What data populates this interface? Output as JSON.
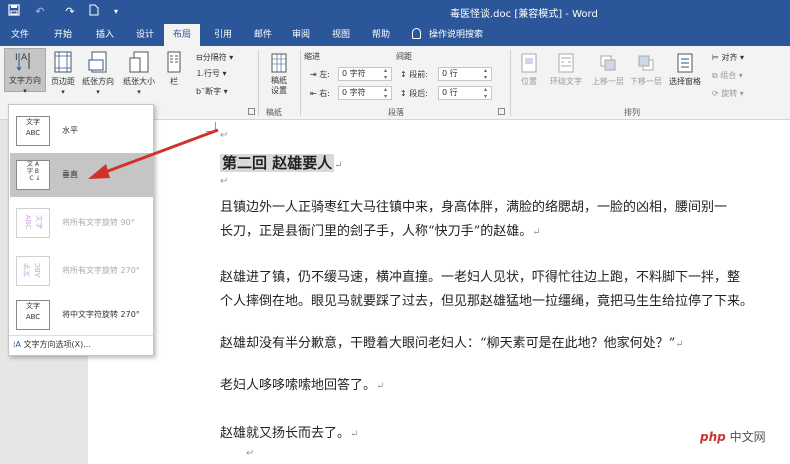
{
  "titlebar": {
    "title": "毒医怪谈.doc [兼容模式] - Word"
  },
  "menu": {
    "tabs": [
      "文件",
      "开始",
      "插入",
      "设计",
      "布局",
      "引用",
      "邮件",
      "审阅",
      "视图",
      "帮助"
    ],
    "active_tab": "布局",
    "tell_me": "操作说明搜索"
  },
  "ribbon": {
    "page_setup": {
      "text_direction": "文字方向",
      "margins": "页边距",
      "orientation": "纸张方向",
      "size": "纸张大小",
      "columns": "栏",
      "breaks": "分隔符",
      "line_numbers": "行号",
      "hyphenation": "断字"
    },
    "draft": {
      "label": "稿纸设置",
      "group": "稿纸"
    },
    "paragraph": {
      "indent_title": "缩进",
      "spacing_title": "间距",
      "left_label": "左:",
      "right_label": "右:",
      "left_value": "0 字符",
      "right_value": "0 字符",
      "before_label": "段前:",
      "after_label": "段后:",
      "before_value": "0 行",
      "after_value": "0 行",
      "group": "段落"
    },
    "arrange": {
      "position": "位置",
      "wrap_text": "环绕文字",
      "bring_forward": "上移一层",
      "send_backward": "下移一层",
      "selection_pane": "选择窗格",
      "align": "对齐",
      "group_btn": "组合",
      "rotate": "旋转",
      "group": "排列"
    }
  },
  "text_direction_menu": {
    "items": [
      {
        "icon_text": "文字ABC",
        "label": "水平",
        "enabled": true,
        "selected": false
      },
      {
        "icon_text": "ABC文字",
        "label": "垂直",
        "enabled": true,
        "selected": true
      },
      {
        "icon_text": "文字ABC",
        "label": "将所有文字旋转 90°",
        "enabled": false,
        "selected": false
      },
      {
        "icon_text": "文字ABC",
        "label": "将所有文字旋转 270°",
        "enabled": false,
        "selected": false
      },
      {
        "icon_text": "文字ABC",
        "label": "将中文字符旋转 270°",
        "enabled": true,
        "selected": false
      }
    ],
    "options_label": "文字方向选项(X)..."
  },
  "document": {
    "heading": "第二回  赵雄要人",
    "lines": [
      "且镇边外一人正骑枣红大马往镇中来，身高体胖，满脸的络腮胡，一脸的凶相，腰间别一",
      "长刀，正是县衙门里的刽子手，人称“快刀手”的赵雄。",
      "赵雄进了镇，仍不缓马速，横冲直撞。一老妇人见状，吓得忙往边上跑，不料脚下一拌，整",
      "个人摔倒在地。眼见马就要踩了过去，但见那赵雄猛地一拉缰绳，竟把马生生给拉停了下来。",
      "赵雄却没有半分歉意，干瞪着大眼问老妇人：“柳天素可是在此地？他家何处？”",
      "老妇人哆哆嗦嗦地回答了。",
      "赵雄就又扬长而去了。"
    ]
  },
  "watermark": {
    "brand": "php",
    "site": "中文网"
  },
  "colors": {
    "accent": "#2b579a",
    "arrow": "#d0312d"
  }
}
